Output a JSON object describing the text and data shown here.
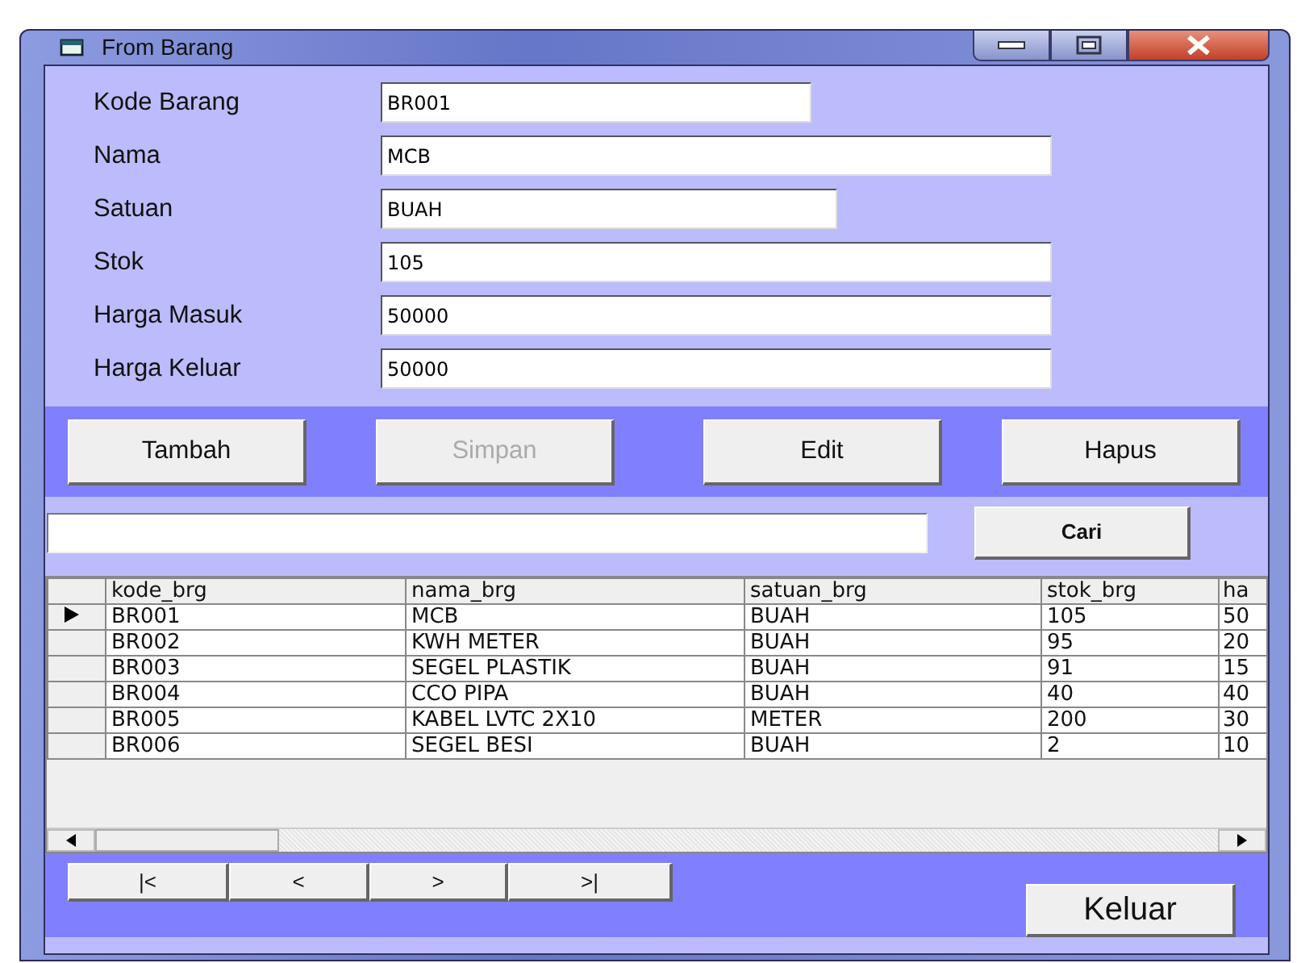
{
  "window": {
    "title": "From Barang"
  },
  "fields": [
    {
      "label": "Kode Barang",
      "value": "BR001"
    },
    {
      "label": "Nama",
      "value": "MCB"
    },
    {
      "label": "Satuan",
      "value": "BUAH"
    },
    {
      "label": "Stok",
      "value": "105"
    },
    {
      "label": "Harga Masuk",
      "value": "50000"
    },
    {
      "label": "Harga Keluar",
      "value": "50000"
    }
  ],
  "actions": [
    {
      "label": "Tambah",
      "disabled": false
    },
    {
      "label": "Simpan",
      "disabled": true
    },
    {
      "label": "Edit",
      "disabled": false
    },
    {
      "label": "Hapus",
      "disabled": false
    }
  ],
  "search": {
    "button": "Cari"
  },
  "table": {
    "columns": [
      "kode_brg",
      "nama_brg",
      "satuan_brg",
      "stok_brg",
      "ha"
    ],
    "rows": [
      {
        "cells": [
          "BR001",
          "MCB",
          "BUAH",
          "105",
          "50"
        ],
        "current": true
      },
      {
        "cells": [
          "BR002",
          "KWH METER",
          "BUAH",
          "95",
          "20"
        ],
        "current": false
      },
      {
        "cells": [
          "BR003",
          "SEGEL PLASTIK",
          "BUAH",
          "91",
          "15"
        ],
        "current": false
      },
      {
        "cells": [
          "BR004",
          "CCO PIPA",
          "BUAH",
          "40",
          "40"
        ],
        "current": false
      },
      {
        "cells": [
          "BR005",
          "KABEL LVTC 2X10",
          "METER",
          "200",
          "30"
        ],
        "current": false
      },
      {
        "cells": [
          "BR006",
          "SEGEL BESI",
          "BUAH",
          "2",
          "10"
        ],
        "current": false
      }
    ]
  },
  "navigation": [
    "|<",
    "<",
    ">",
    ">|"
  ],
  "exit_button": "Keluar"
}
